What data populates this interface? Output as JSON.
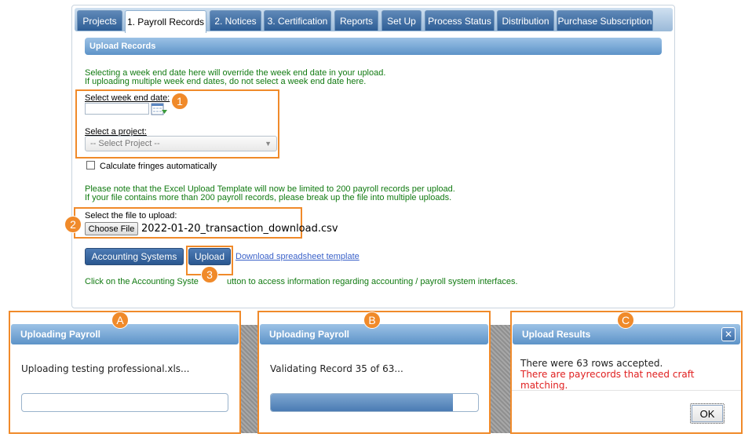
{
  "tabs": [
    {
      "label": "Projects",
      "active": false
    },
    {
      "label": "1. Payroll Records",
      "active": true
    },
    {
      "label": "2. Notices",
      "active": false
    },
    {
      "label": "3. Certification",
      "active": false
    },
    {
      "label": "Reports",
      "active": false
    },
    {
      "label": "Set Up",
      "active": false
    },
    {
      "label": "Process Status",
      "active": false
    },
    {
      "label": "Distribution",
      "active": false
    },
    {
      "label": "Purchase Subscription",
      "active": false
    }
  ],
  "section": {
    "title": "Upload Records",
    "note_line1": "Selecting a week end date here will override the week end date in your upload.",
    "note_line2": "If uploading multiple week end dates, do not select a week end date here."
  },
  "form": {
    "week_end_label": "Select week end date:",
    "week_end_value": "",
    "project_label": "Select a project:",
    "project_selected": "-- Select Project --",
    "fringes_label": "Calculate fringes automatically",
    "fringes_checked": false,
    "limit_line1": "Please note that the Excel Upload Template will now be limited to 200 payroll records per upload.",
    "limit_line2": "If your file contains more than 200 payroll records, please break up the file into multiple uploads.",
    "file_label": "Select the file to upload:",
    "choose_file_label": "Choose File",
    "file_name": "2022-01-20_transaction_download.csv",
    "accounting_button": "Accounting Systems",
    "upload_button": "Upload",
    "download_link": "Download spreadsheet template",
    "accounting_note_a": "Click on the Accounting Syste",
    "accounting_note_b": "utton to access information regarding accounting / payroll system interfaces."
  },
  "badges": {
    "b1": "1",
    "b2": "2",
    "b3": "3",
    "ba": "A",
    "bb": "B",
    "bc": "C"
  },
  "dialogs": {
    "a": {
      "title": "Uploading Payroll",
      "message": "Uploading testing professional.xls...",
      "progress": 0
    },
    "b": {
      "title": "Uploading Payroll",
      "message": "Validating Record 35 of 63...",
      "progress": 0.88
    },
    "c": {
      "title": "Upload Results",
      "line1": "There were 63 rows accepted.",
      "line2": "There are payrecords that need craft matching.",
      "ok_label": "OK"
    }
  },
  "colors": {
    "accent_orange": "#f08a2a",
    "note_green": "#117a11",
    "error_red": "#e02020",
    "brand_blue": "#2e5e96"
  }
}
